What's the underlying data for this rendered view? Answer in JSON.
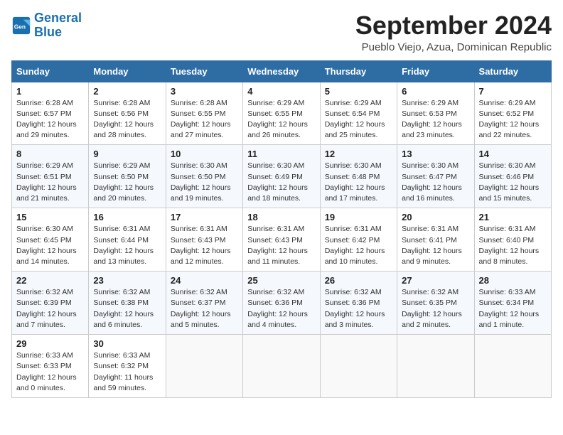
{
  "logo": {
    "text_general": "General",
    "text_blue": "Blue"
  },
  "header": {
    "month": "September 2024",
    "location": "Pueblo Viejo, Azua, Dominican Republic"
  },
  "days_of_week": [
    "Sunday",
    "Monday",
    "Tuesday",
    "Wednesday",
    "Thursday",
    "Friday",
    "Saturday"
  ],
  "weeks": [
    [
      {
        "day": "1",
        "sunrise": "6:28 AM",
        "sunset": "6:57 PM",
        "daylight": "12 hours and 29 minutes."
      },
      {
        "day": "2",
        "sunrise": "6:28 AM",
        "sunset": "6:56 PM",
        "daylight": "12 hours and 28 minutes."
      },
      {
        "day": "3",
        "sunrise": "6:28 AM",
        "sunset": "6:55 PM",
        "daylight": "12 hours and 27 minutes."
      },
      {
        "day": "4",
        "sunrise": "6:29 AM",
        "sunset": "6:55 PM",
        "daylight": "12 hours and 26 minutes."
      },
      {
        "day": "5",
        "sunrise": "6:29 AM",
        "sunset": "6:54 PM",
        "daylight": "12 hours and 25 minutes."
      },
      {
        "day": "6",
        "sunrise": "6:29 AM",
        "sunset": "6:53 PM",
        "daylight": "12 hours and 23 minutes."
      },
      {
        "day": "7",
        "sunrise": "6:29 AM",
        "sunset": "6:52 PM",
        "daylight": "12 hours and 22 minutes."
      }
    ],
    [
      {
        "day": "8",
        "sunrise": "6:29 AM",
        "sunset": "6:51 PM",
        "daylight": "12 hours and 21 minutes."
      },
      {
        "day": "9",
        "sunrise": "6:29 AM",
        "sunset": "6:50 PM",
        "daylight": "12 hours and 20 minutes."
      },
      {
        "day": "10",
        "sunrise": "6:30 AM",
        "sunset": "6:50 PM",
        "daylight": "12 hours and 19 minutes."
      },
      {
        "day": "11",
        "sunrise": "6:30 AM",
        "sunset": "6:49 PM",
        "daylight": "12 hours and 18 minutes."
      },
      {
        "day": "12",
        "sunrise": "6:30 AM",
        "sunset": "6:48 PM",
        "daylight": "12 hours and 17 minutes."
      },
      {
        "day": "13",
        "sunrise": "6:30 AM",
        "sunset": "6:47 PM",
        "daylight": "12 hours and 16 minutes."
      },
      {
        "day": "14",
        "sunrise": "6:30 AM",
        "sunset": "6:46 PM",
        "daylight": "12 hours and 15 minutes."
      }
    ],
    [
      {
        "day": "15",
        "sunrise": "6:30 AM",
        "sunset": "6:45 PM",
        "daylight": "12 hours and 14 minutes."
      },
      {
        "day": "16",
        "sunrise": "6:31 AM",
        "sunset": "6:44 PM",
        "daylight": "12 hours and 13 minutes."
      },
      {
        "day": "17",
        "sunrise": "6:31 AM",
        "sunset": "6:43 PM",
        "daylight": "12 hours and 12 minutes."
      },
      {
        "day": "18",
        "sunrise": "6:31 AM",
        "sunset": "6:43 PM",
        "daylight": "12 hours and 11 minutes."
      },
      {
        "day": "19",
        "sunrise": "6:31 AM",
        "sunset": "6:42 PM",
        "daylight": "12 hours and 10 minutes."
      },
      {
        "day": "20",
        "sunrise": "6:31 AM",
        "sunset": "6:41 PM",
        "daylight": "12 hours and 9 minutes."
      },
      {
        "day": "21",
        "sunrise": "6:31 AM",
        "sunset": "6:40 PM",
        "daylight": "12 hours and 8 minutes."
      }
    ],
    [
      {
        "day": "22",
        "sunrise": "6:32 AM",
        "sunset": "6:39 PM",
        "daylight": "12 hours and 7 minutes."
      },
      {
        "day": "23",
        "sunrise": "6:32 AM",
        "sunset": "6:38 PM",
        "daylight": "12 hours and 6 minutes."
      },
      {
        "day": "24",
        "sunrise": "6:32 AM",
        "sunset": "6:37 PM",
        "daylight": "12 hours and 5 minutes."
      },
      {
        "day": "25",
        "sunrise": "6:32 AM",
        "sunset": "6:36 PM",
        "daylight": "12 hours and 4 minutes."
      },
      {
        "day": "26",
        "sunrise": "6:32 AM",
        "sunset": "6:36 PM",
        "daylight": "12 hours and 3 minutes."
      },
      {
        "day": "27",
        "sunrise": "6:32 AM",
        "sunset": "6:35 PM",
        "daylight": "12 hours and 2 minutes."
      },
      {
        "day": "28",
        "sunrise": "6:33 AM",
        "sunset": "6:34 PM",
        "daylight": "12 hours and 1 minute."
      }
    ],
    [
      {
        "day": "29",
        "sunrise": "6:33 AM",
        "sunset": "6:33 PM",
        "daylight": "12 hours and 0 minutes."
      },
      {
        "day": "30",
        "sunrise": "6:33 AM",
        "sunset": "6:32 PM",
        "daylight": "11 hours and 59 minutes."
      },
      null,
      null,
      null,
      null,
      null
    ]
  ],
  "labels": {
    "sunrise": "Sunrise:",
    "sunset": "Sunset:",
    "daylight": "Daylight:"
  }
}
